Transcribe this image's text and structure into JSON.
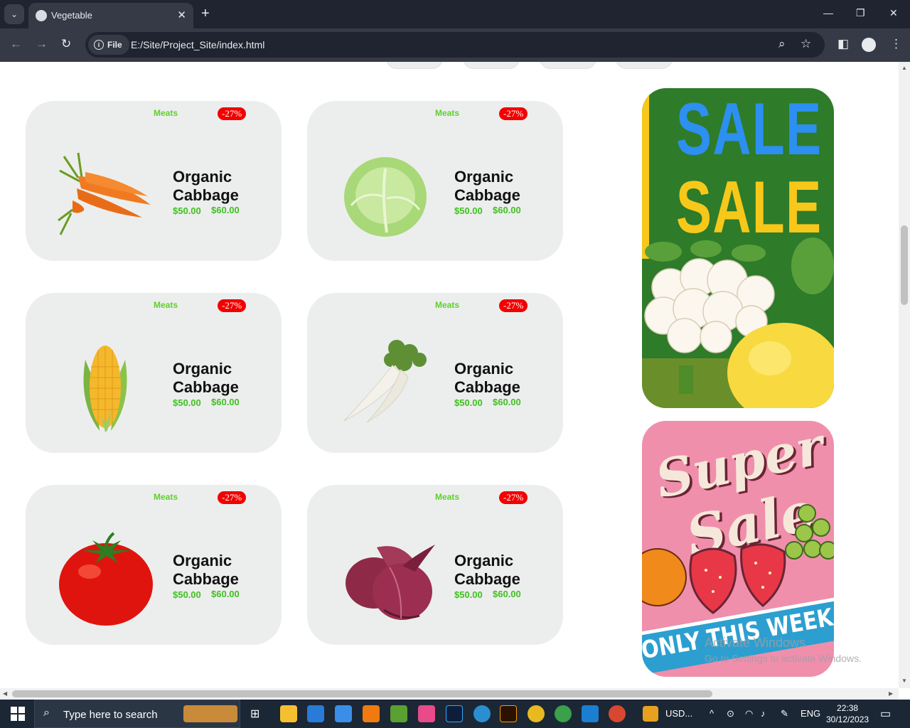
{
  "browser": {
    "tab_title": "Vegetable",
    "tab_close": "✕",
    "new_tab": "+",
    "site_chip": "File",
    "url": "E:/Site/Project_Site/index.html"
  },
  "cards": [
    {
      "category": "Meats",
      "discount": "-27%",
      "name": "Organic Cabbage",
      "price": "$50.00",
      "old_price": "$60.00",
      "image": "carrot-image"
    },
    {
      "category": "Meats",
      "discount": "-27%",
      "name": "Organic Cabbage",
      "price": "$50.00",
      "old_price": "$60.00",
      "image": "cabbage-image"
    },
    {
      "category": "Meats",
      "discount": "-27%",
      "name": "Organic Cabbage",
      "price": "$50.00",
      "old_price": "$60.00",
      "image": "corn-image"
    },
    {
      "category": "Meats",
      "discount": "-27%",
      "name": "Organic Cabbage",
      "price": "$50.00",
      "old_price": "$60.00",
      "image": "radish-image"
    },
    {
      "category": "Meats",
      "discount": "-27%",
      "name": "Organic Cabbage",
      "price": "$50.00",
      "old_price": "$60.00",
      "image": "tomato-image"
    },
    {
      "category": "Meats",
      "discount": "-27%",
      "name": "Organic Cabbage",
      "price": "$50.00",
      "old_price": "$60.00",
      "image": "onion-image"
    }
  ],
  "banners": {
    "sale_top": "SALE",
    "sale_bottom": "SALE",
    "super_top": "Super",
    "super_bottom": "Sale",
    "super_band": "ONLY THIS WEEK"
  },
  "watermark": {
    "line1": "Activate Windows",
    "line2": "Go to Settings to activate Windows."
  },
  "taskbar": {
    "search_placeholder": "Type here to search",
    "widget_label": "USD...",
    "language": "ENG",
    "time": "22:38",
    "date": "30/12/2023"
  },
  "colors": {
    "card_bg": "#eceeed",
    "category": "#5bd327",
    "discount_bg": "#f20000",
    "price": "#40c020"
  }
}
